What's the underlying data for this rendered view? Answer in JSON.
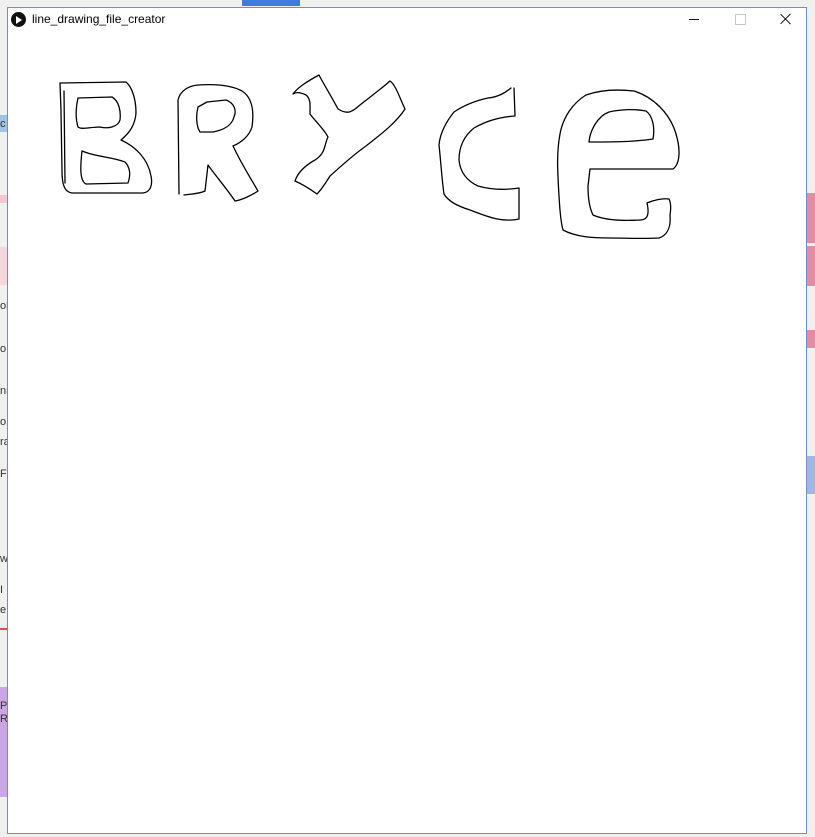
{
  "window": {
    "title": "line_drawing_file_creator",
    "icon": "play-icon",
    "controls": [
      "minimize-icon",
      "maximize-icon",
      "close-icon"
    ]
  },
  "canvas": {
    "background": "#ffffff",
    "stroke_color": "#000000"
  },
  "background_window_fragments": [
    "c",
    "ol",
    "o",
    "nr",
    "o",
    "ra",
    "F",
    "w",
    "I",
    "e",
    "P",
    "R"
  ]
}
